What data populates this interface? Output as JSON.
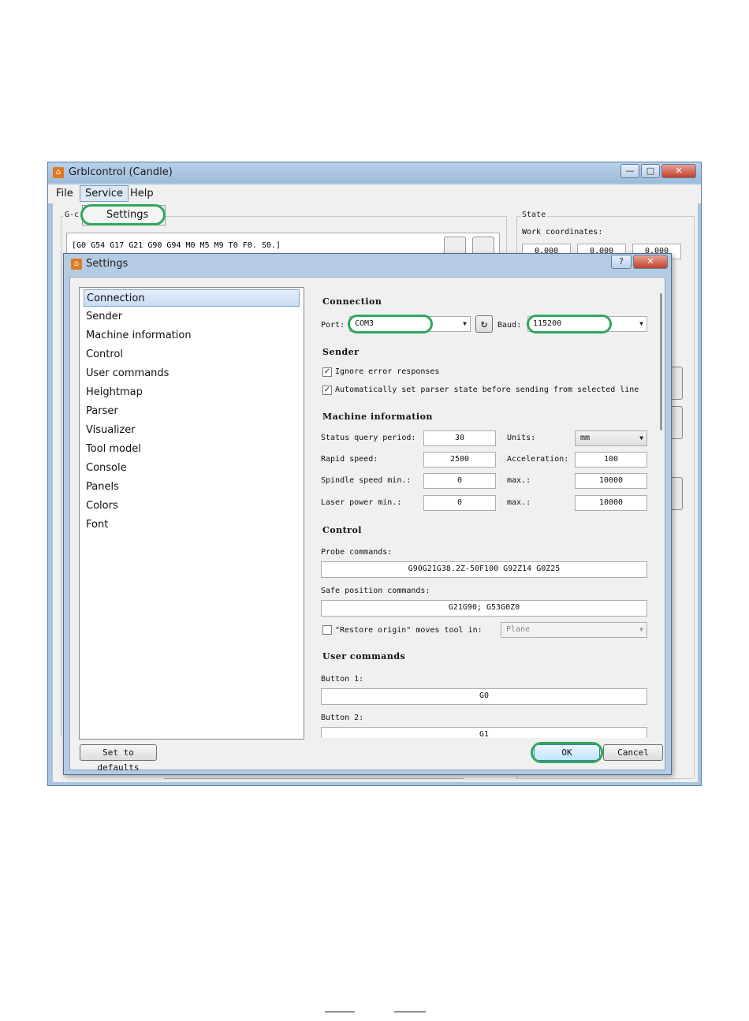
{
  "main_window": {
    "title": "Grblcontrol  (Candle)",
    "app_icon_glyph": "⌂",
    "minimize_glyph": "—",
    "maximize_glyph": "□",
    "close_glyph": "✕",
    "menu": {
      "file": "File",
      "service": "Service",
      "help": "Help"
    },
    "gcode_group_label": "G-c",
    "gcode_state": "[G0 G54 G17 G21 G90 G94 M0 M5 M9 T0 F0. S0.]",
    "state_group_label": "State",
    "work_coordinates_label": "Work coordinates:",
    "work_coordinates": [
      "0.000",
      "0.000",
      "0.000"
    ]
  },
  "service_menu": {
    "settings": "Settings"
  },
  "dialog": {
    "title": "Settings",
    "help_glyph": "?",
    "close_glyph": "✕",
    "nav_items": [
      "Connection",
      "Sender",
      "Machine information",
      "Control",
      "User commands",
      "Heightmap",
      "Parser",
      "Visualizer",
      "Tool model",
      "Console",
      "Panels",
      "Colors",
      "Font"
    ],
    "selected_nav": "Connection",
    "connection": {
      "heading": "Connection",
      "port_label": "Port:",
      "port_value": "COM3",
      "refresh_glyph": "↻",
      "baud_label": "Baud:",
      "baud_value": "115200"
    },
    "sender": {
      "heading": "Sender",
      "ignore_errors_label": "Ignore error responses",
      "ignore_errors_checked": true,
      "auto_parser_label": "Automatically set parser state before sending from selected line",
      "auto_parser_checked": true
    },
    "machine_information": {
      "heading": "Machine information",
      "status_query_label": "Status query period:",
      "status_query_value": "30",
      "units_label": "Units:",
      "units_value": "mm",
      "rapid_speed_label": "Rapid speed:",
      "rapid_speed_value": "2500",
      "acceleration_label": "Acceleration:",
      "acceleration_value": "100",
      "spindle_min_label": "Spindle speed min.:",
      "spindle_min_value": "0",
      "spindle_max_label": "max.:",
      "spindle_max_value": "10000",
      "laser_min_label": "Laser power min.:",
      "laser_min_value": "0",
      "laser_max_label": "max.:",
      "laser_max_value": "10000"
    },
    "control": {
      "heading": "Control",
      "probe_label": "Probe commands:",
      "probe_value": "G90G21G38.2Z-50F100 G92Z14 G0Z25",
      "safe_position_label": "Safe position commands:",
      "safe_position_value": "G21G90; G53G0Z0",
      "restore_origin_label": "\"Restore origin\" moves tool in:",
      "restore_origin_checked": false,
      "restore_origin_value": "Plane"
    },
    "user_commands": {
      "heading": "User commands",
      "button1_label": "Button 1:",
      "button1_value": "G0",
      "button2_label": "Button 2:",
      "button2_value": "G1"
    },
    "buttons": {
      "defaults": "Set to defaults",
      "ok": "OK",
      "cancel": "Cancel"
    }
  },
  "colors": {
    "highlight": "#2fa85b",
    "accent": "#b4cbe3"
  }
}
